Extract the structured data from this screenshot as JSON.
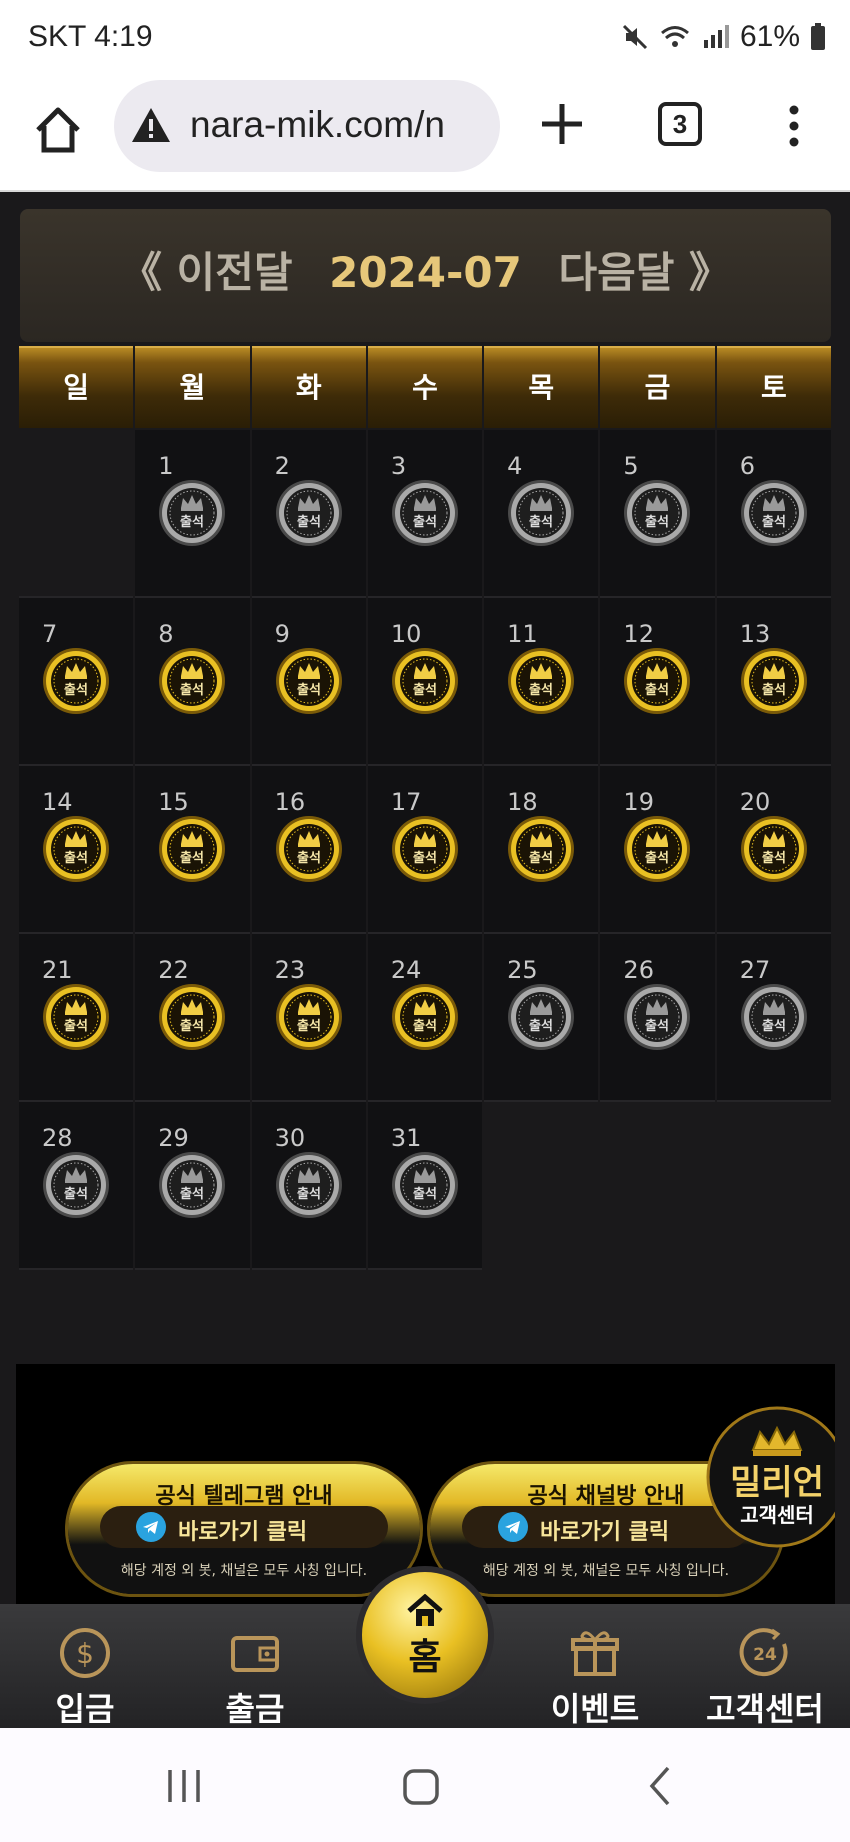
{
  "status_bar": {
    "carrier_time": "SKT 4:19",
    "battery": "61%"
  },
  "browser": {
    "url": "nara-mik.com/n",
    "tab_count": "3"
  },
  "calendar": {
    "prev_label": "《 이전달",
    "month": "2024-07",
    "next_label": "다음달 》",
    "weekdays": [
      "일",
      "월",
      "화",
      "수",
      "목",
      "금",
      "토"
    ],
    "days": [
      {
        "day": "",
        "status": "empty"
      },
      {
        "day": "1",
        "status": "absent"
      },
      {
        "day": "2",
        "status": "absent"
      },
      {
        "day": "3",
        "status": "absent"
      },
      {
        "day": "4",
        "status": "absent"
      },
      {
        "day": "5",
        "status": "absent"
      },
      {
        "day": "6",
        "status": "absent"
      },
      {
        "day": "7",
        "status": "attended"
      },
      {
        "day": "8",
        "status": "attended"
      },
      {
        "day": "9",
        "status": "attended"
      },
      {
        "day": "10",
        "status": "attended"
      },
      {
        "day": "11",
        "status": "attended"
      },
      {
        "day": "12",
        "status": "attended"
      },
      {
        "day": "13",
        "status": "attended"
      },
      {
        "day": "14",
        "status": "attended"
      },
      {
        "day": "15",
        "status": "attended"
      },
      {
        "day": "16",
        "status": "attended"
      },
      {
        "day": "17",
        "status": "attended"
      },
      {
        "day": "18",
        "status": "attended"
      },
      {
        "day": "19",
        "status": "attended"
      },
      {
        "day": "20",
        "status": "attended"
      },
      {
        "day": "21",
        "status": "attended"
      },
      {
        "day": "22",
        "status": "attended"
      },
      {
        "day": "23",
        "status": "attended"
      },
      {
        "day": "24",
        "status": "attended"
      },
      {
        "day": "25",
        "status": "absent"
      },
      {
        "day": "26",
        "status": "absent"
      },
      {
        "day": "27",
        "status": "absent"
      },
      {
        "day": "28",
        "status": "absent"
      },
      {
        "day": "29",
        "status": "absent"
      },
      {
        "day": "30",
        "status": "absent"
      },
      {
        "day": "31",
        "status": "absent"
      }
    ],
    "badge_label": "출석"
  },
  "banner": {
    "promos": [
      {
        "title": "공식 텔레그램 안내",
        "button": "바로가기 클릭",
        "note": "해당 계정 외 봇, 채널은 모두 사칭 입니다."
      },
      {
        "title": "공식 채널방 안내",
        "button": "바로가기 클릭",
        "note": "해당 계정 외 봇, 채널은 모두 사칭 입니다."
      }
    ],
    "million_title": "밀리언",
    "million_sub": "고객센터"
  },
  "bottom_nav": {
    "deposit": "입금",
    "withdraw": "출금",
    "home": "홈",
    "event": "이벤트",
    "support": "고객센터"
  },
  "colors": {
    "gold": "#e6c77a",
    "background": "#1a191b",
    "cell": "#111113"
  }
}
